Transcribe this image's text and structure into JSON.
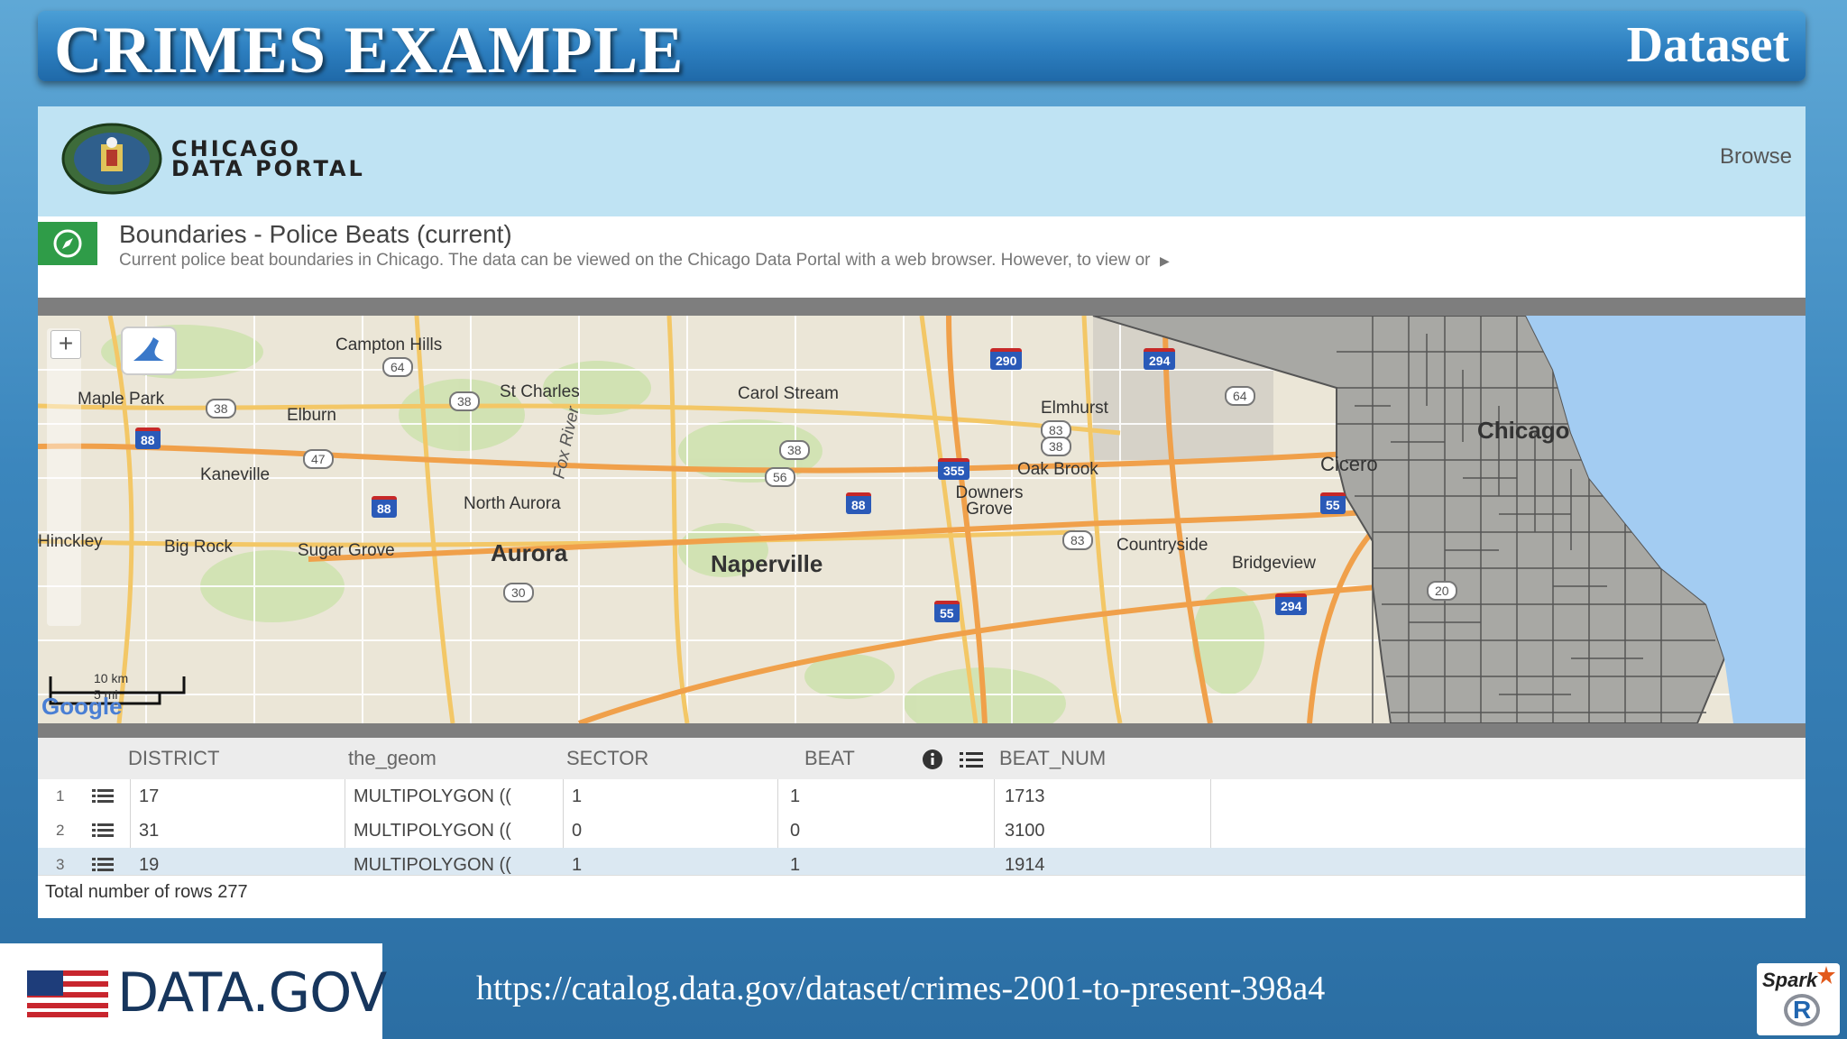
{
  "slide": {
    "title": "CRIMES EXAMPLE",
    "subtitle": "Dataset",
    "url": "https://catalog.data.gov/dataset/crimes-2001-to-present-398a4"
  },
  "portal": {
    "name_line1": "CHICAGO",
    "name_line2": "DATA PORTAL",
    "nav_browse": "Browse",
    "dataset_title": "Boundaries - Police Beats (current)",
    "dataset_desc": "Current police beat boundaries in Chicago. The data can be viewed on the Chicago Data Portal with a web browser. However, to view or"
  },
  "map": {
    "places": {
      "campton_hills": "Campton Hills",
      "maple_park": "Maple Park",
      "elburn": "Elburn",
      "st_charles": "St Charles",
      "carol_stream": "Carol Stream",
      "elmhurst": "Elmhurst",
      "chicago": "Chicago",
      "cicero": "Cicero",
      "oak_brook": "Oak Brook",
      "downers_grove": "Downers Grove",
      "kaneville": "Kaneville",
      "north_aurora": "North Aurora",
      "hinckley": "Hinckley",
      "big_rock": "Big Rock",
      "sugar_grove": "Sugar Grove",
      "aurora": "Aurora",
      "naperville": "Naperville",
      "countryside": "Countryside",
      "bridgeview": "Bridgeview",
      "fox_river": "Fox River"
    },
    "interstates": [
      "290",
      "294",
      "88",
      "355",
      "88",
      "88",
      "55",
      "55",
      "294"
    ],
    "state_routes": [
      "64",
      "38",
      "38",
      "47",
      "38",
      "56",
      "83",
      "38",
      "64",
      "83",
      "30",
      "20"
    ],
    "scale_label_km": "10 km",
    "scale_label_mi": "5 mi",
    "attribution": "Google"
  },
  "table": {
    "columns": [
      "DISTRICT",
      "the_geom",
      "SECTOR",
      "BEAT",
      "BEAT_NUM"
    ],
    "rows": [
      {
        "n": "1",
        "district": "17",
        "geom": "MULTIPOLYGON ((",
        "sector": "1",
        "beat": "1",
        "beat_num": "1713"
      },
      {
        "n": "2",
        "district": "31",
        "geom": "MULTIPOLYGON ((",
        "sector": "0",
        "beat": "0",
        "beat_num": "3100"
      },
      {
        "n": "3",
        "district": "19",
        "geom": "MULTIPOLYGON ((",
        "sector": "1",
        "beat": "1",
        "beat_num": "1914"
      }
    ],
    "total_rows": "Total number of rows 277"
  },
  "footer": {
    "datagov_label": "DATA.GOV",
    "spark_label": "Spark",
    "r_label": "R"
  },
  "colors": {
    "title_bar": "#2d7fc0",
    "portal_header_bg": "#bfe3f3",
    "compass_green": "#2f9c48",
    "beat_fill": "#9e9e9e",
    "lake": "#a3ccf2"
  }
}
